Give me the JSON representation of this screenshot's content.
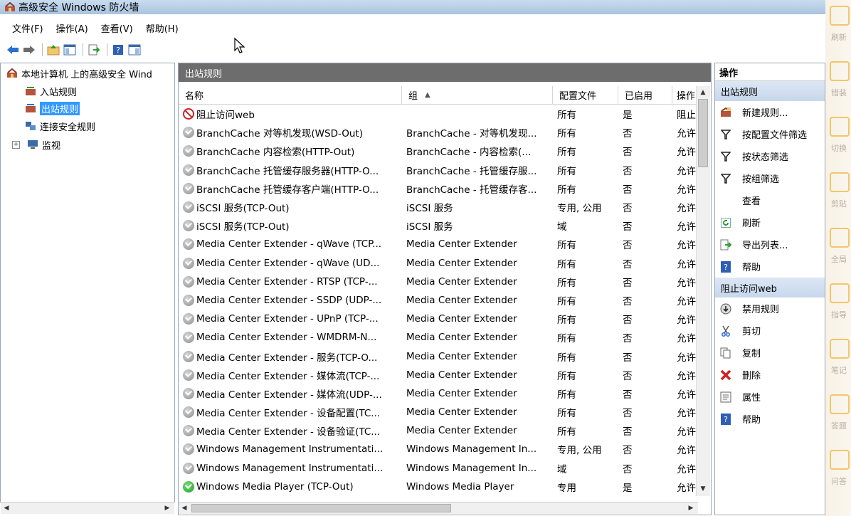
{
  "window": {
    "title": "高级安全 Windows 防火墙"
  },
  "menu": [
    "文件(F)",
    "操作(A)",
    "查看(V)",
    "帮助(H)"
  ],
  "toolbar": {
    "buttons": [
      "back-arrow-icon",
      "forward-arrow-icon",
      "up-folder-icon",
      "show-hide-tree-icon",
      "export-icon",
      "help-icon",
      "show-hide-action-pane-icon"
    ]
  },
  "tree": {
    "root": "本地计算机 上的高级安全 Wind",
    "items": [
      {
        "label": "入站规则",
        "selected": false
      },
      {
        "label": "出站规则",
        "selected": true
      },
      {
        "label": "连接安全规则",
        "selected": false
      },
      {
        "label": "监视",
        "selected": false,
        "expander": "+"
      }
    ]
  },
  "center": {
    "header": "出站规则",
    "columns": [
      "名称",
      "组",
      "配置文件",
      "已启用",
      "操作"
    ],
    "rows": [
      {
        "icon": "block",
        "name": "阻止访问web",
        "group": "",
        "profile": "所有",
        "enabled": "是",
        "action": "阻止"
      },
      {
        "icon": "gray",
        "name": "BranchCache 对等机发现(WSD-Out)",
        "group": "BranchCache - 对等机发现...",
        "profile": "所有",
        "enabled": "否",
        "action": "允许"
      },
      {
        "icon": "gray",
        "name": "BranchCache 内容检索(HTTP-Out)",
        "group": "BranchCache - 内容检索(...",
        "profile": "所有",
        "enabled": "否",
        "action": "允许"
      },
      {
        "icon": "gray",
        "name": "BranchCache 托管缓存服务器(HTTP-O...",
        "group": "BranchCache - 托管缓存服...",
        "profile": "所有",
        "enabled": "否",
        "action": "允许"
      },
      {
        "icon": "gray",
        "name": "BranchCache 托管缓存客户端(HTTP-O...",
        "group": "BranchCache - 托管缓存客...",
        "profile": "所有",
        "enabled": "否",
        "action": "允许"
      },
      {
        "icon": "gray",
        "name": "iSCSI 服务(TCP-Out)",
        "group": "iSCSI 服务",
        "profile": "专用, 公用",
        "enabled": "否",
        "action": "允许"
      },
      {
        "icon": "gray",
        "name": "iSCSI 服务(TCP-Out)",
        "group": "iSCSI 服务",
        "profile": "域",
        "enabled": "否",
        "action": "允许"
      },
      {
        "icon": "gray",
        "name": "Media Center Extender - qWave (TCP...",
        "group": "Media Center Extender",
        "profile": "所有",
        "enabled": "否",
        "action": "允许"
      },
      {
        "icon": "gray",
        "name": "Media Center Extender - qWave (UD...",
        "group": "Media Center Extender",
        "profile": "所有",
        "enabled": "否",
        "action": "允许"
      },
      {
        "icon": "gray",
        "name": "Media Center Extender - RTSP (TCP-...",
        "group": "Media Center Extender",
        "profile": "所有",
        "enabled": "否",
        "action": "允许"
      },
      {
        "icon": "gray",
        "name": "Media Center Extender - SSDP (UDP-...",
        "group": "Media Center Extender",
        "profile": "所有",
        "enabled": "否",
        "action": "允许"
      },
      {
        "icon": "gray",
        "name": "Media Center Extender - UPnP (TCP-...",
        "group": "Media Center Extender",
        "profile": "所有",
        "enabled": "否",
        "action": "允许"
      },
      {
        "icon": "gray",
        "name": "Media Center Extender - WMDRM-N...",
        "group": "Media Center Extender",
        "profile": "所有",
        "enabled": "否",
        "action": "允许"
      },
      {
        "icon": "gray",
        "name": "Media Center Extender - 服务(TCP-O...",
        "group": "Media Center Extender",
        "profile": "所有",
        "enabled": "否",
        "action": "允许"
      },
      {
        "icon": "gray",
        "name": "Media Center Extender - 媒体流(TCP-...",
        "group": "Media Center Extender",
        "profile": "所有",
        "enabled": "否",
        "action": "允许"
      },
      {
        "icon": "gray",
        "name": "Media Center Extender - 媒体流(UDP-...",
        "group": "Media Center Extender",
        "profile": "所有",
        "enabled": "否",
        "action": "允许"
      },
      {
        "icon": "gray",
        "name": "Media Center Extender - 设备配置(TC...",
        "group": "Media Center Extender",
        "profile": "所有",
        "enabled": "否",
        "action": "允许"
      },
      {
        "icon": "gray",
        "name": "Media Center Extender - 设备验证(TC...",
        "group": "Media Center Extender",
        "profile": "所有",
        "enabled": "否",
        "action": "允许"
      },
      {
        "icon": "gray",
        "name": "Windows Management Instrumentati...",
        "group": "Windows Management In...",
        "profile": "专用, 公用",
        "enabled": "否",
        "action": "允许"
      },
      {
        "icon": "gray",
        "name": "Windows Management Instrumentati...",
        "group": "Windows Management In...",
        "profile": "域",
        "enabled": "否",
        "action": "允许"
      },
      {
        "icon": "green",
        "name": "Windows Media Player (TCP-Out)",
        "group": "Windows Media Player",
        "profile": "专用",
        "enabled": "是",
        "action": "允许"
      }
    ]
  },
  "actions": {
    "title": "操作",
    "section1": "出站规则",
    "items1": [
      {
        "label": "新建规则...",
        "icon": "new-rule-icon"
      },
      {
        "label": "按配置文件筛选",
        "icon": "filter-icon"
      },
      {
        "label": "按状态筛选",
        "icon": "filter-icon"
      },
      {
        "label": "按组筛选",
        "icon": "filter-icon"
      },
      {
        "label": "查看",
        "icon": ""
      },
      {
        "label": "刷新",
        "icon": "refresh-icon"
      },
      {
        "label": "导出列表...",
        "icon": "export-icon"
      },
      {
        "label": "帮助",
        "icon": "help-icon"
      }
    ],
    "section2": "阻止访问web",
    "items2": [
      {
        "label": "禁用规则",
        "icon": "disable-icon"
      },
      {
        "label": "剪切",
        "icon": "cut-icon"
      },
      {
        "label": "复制",
        "icon": "copy-icon"
      },
      {
        "label": "删除",
        "icon": "delete-icon"
      },
      {
        "label": "属性",
        "icon": "properties-icon"
      },
      {
        "label": "帮助",
        "icon": "help-icon"
      }
    ]
  },
  "edge": {
    "labels": [
      "刷新",
      "错装",
      "切换",
      "剪贴",
      "全局",
      "指导",
      "笔记",
      "答题",
      "问答"
    ]
  },
  "colors": {
    "accent": "#3399ff",
    "header": "#6d6d6d",
    "block": "#d02020",
    "enabled": "#1f9a1f"
  }
}
